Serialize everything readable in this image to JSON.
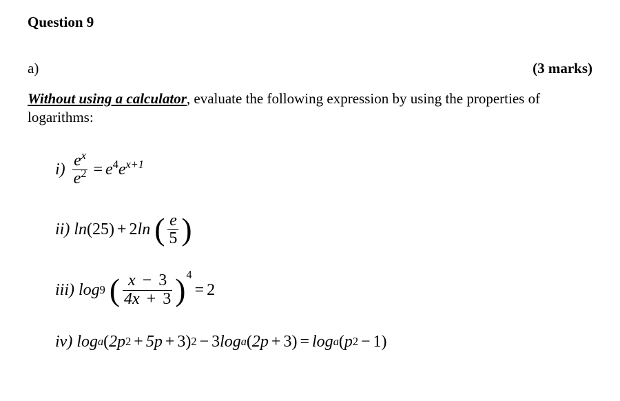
{
  "header": "Question 9",
  "part": {
    "label": "a)",
    "marks": "(3 marks)"
  },
  "instruction": {
    "emph": "Without using a calculator",
    "rest": ", evaluate the following expression by using the properties of logarithms:"
  },
  "items": {
    "i": {
      "roman": "i)",
      "lhs_num": "e",
      "lhs_num_exp": "x",
      "lhs_den": "e",
      "lhs_den_exp": "2",
      "eq": "=",
      "rhs_a": "e",
      "rhs_a_exp": "4",
      "rhs_b": "e",
      "rhs_b_exp": "x+1"
    },
    "ii": {
      "roman": "ii)",
      "t1": "ln",
      "t1_arg": "(25)",
      "plus": "+",
      "t2_coef": "2",
      "t2": "ln",
      "frac_num": "e",
      "frac_den": "5"
    },
    "iii": {
      "roman": "iii)",
      "func": "log",
      "base": "9",
      "frac_num_a": "x",
      "frac_num_op": "−",
      "frac_num_b": "3",
      "frac_den_a": "4x",
      "frac_den_op": "+",
      "frac_den_b": "3",
      "outer_exp": "4",
      "eq": "=",
      "rhs": "2"
    },
    "iv": {
      "roman": "iv)",
      "t1_func": "log",
      "t1_base": "a",
      "t1_open": "(",
      "t1_a": "2p",
      "t1_a_exp": "2",
      "t1_op1": "+",
      "t1_b": "5p",
      "t1_op2": "+",
      "t1_c": "3",
      "t1_close": ")",
      "t1_outer_exp": "2",
      "minus": "−",
      "t2_coef": "3",
      "t2_func": "log",
      "t2_base": "a",
      "t2_arg_open": "(",
      "t2_a": "2p",
      "t2_op": "+",
      "t2_b": "3",
      "t2_arg_close": ")",
      "eq": "=",
      "t3_func": "log",
      "t3_base": "a",
      "t3_open": "(",
      "t3_a": "p",
      "t3_a_exp": "2",
      "t3_op": "−",
      "t3_b": "1",
      "t3_close": ")"
    }
  }
}
